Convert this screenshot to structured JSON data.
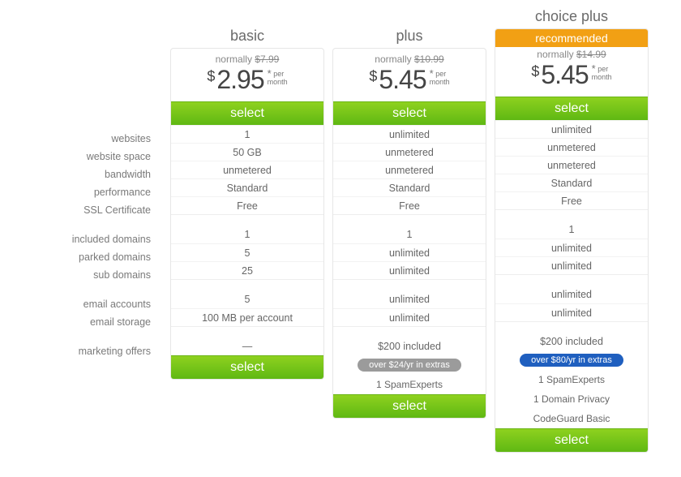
{
  "labels": {
    "websites": "websites",
    "website_space": "website space",
    "bandwidth": "bandwidth",
    "performance": "performance",
    "ssl": "SSL Certificate",
    "included_domains": "included domains",
    "parked_domains": "parked domains",
    "sub_domains": "sub domains",
    "email_accounts": "email accounts",
    "email_storage": "email storage",
    "marketing_offers": "marketing offers"
  },
  "select_label": "select",
  "currency": "$",
  "per_label_top": "* per",
  "per_label_bottom": "month",
  "normally_prefix": "normally",
  "plans": {
    "basic": {
      "title": "basic",
      "normally": "$7.99",
      "price": "2.95",
      "features": {
        "websites": "1",
        "website_space": "50 GB",
        "bandwidth": "unmetered",
        "performance": "Standard",
        "ssl": "Free",
        "included_domains": "1",
        "parked_domains": "5",
        "sub_domains": "25",
        "email_accounts": "5",
        "email_storage": "100 MB per account",
        "marketing_offers": "—"
      }
    },
    "plus": {
      "title": "plus",
      "normally": "$10.99",
      "price": "5.45",
      "features": {
        "websites": "unlimited",
        "website_space": "unmetered",
        "bandwidth": "unmetered",
        "performance": "Standard",
        "ssl": "Free",
        "included_domains": "1",
        "parked_domains": "unlimited",
        "sub_domains": "unlimited",
        "email_accounts": "unlimited",
        "email_storage": "unlimited",
        "marketing_offers": "$200 included"
      },
      "extras_pill": "over $24/yr in extras",
      "extras": {
        "e0": "1 SpamExperts"
      }
    },
    "choice_plus": {
      "title": "choice plus",
      "badge": "recommended",
      "normally": "$14.99",
      "price": "5.45",
      "features": {
        "websites": "unlimited",
        "website_space": "unmetered",
        "bandwidth": "unmetered",
        "performance": "Standard",
        "ssl": "Free",
        "included_domains": "1",
        "parked_domains": "unlimited",
        "sub_domains": "unlimited",
        "email_accounts": "unlimited",
        "email_storage": "unlimited",
        "marketing_offers": "$200 included"
      },
      "extras_pill": "over $80/yr in extras",
      "extras": {
        "e0": "1 SpamExperts",
        "e1": "1 Domain Privacy",
        "e2": "CodeGuard Basic"
      }
    }
  }
}
